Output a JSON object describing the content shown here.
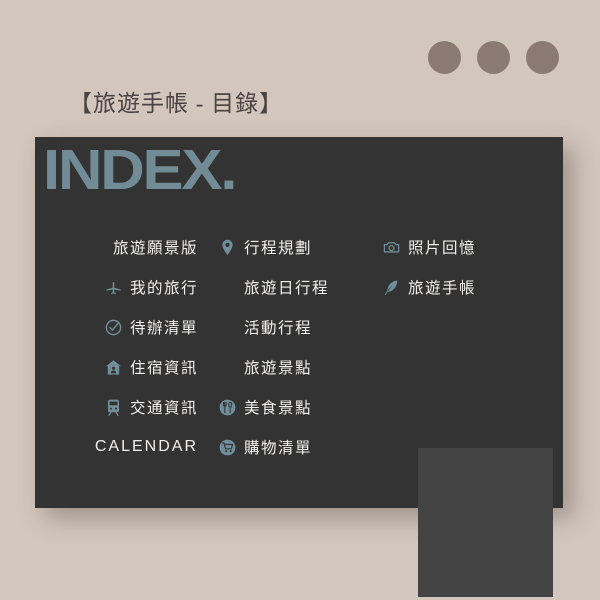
{
  "page": {
    "background_color": "#d2c6bd",
    "title": "【旅遊手帳 - 目錄】"
  },
  "decor": {
    "dot_color": "#8a7a73",
    "dots": [
      "dot-1",
      "dot-2",
      "dot-3"
    ]
  },
  "card": {
    "background_color": "#333333",
    "heading": "INDEX.",
    "heading_color": "#718c96",
    "accent_color": "#6f8e99",
    "text_color": "#f2f0ee",
    "columns": [
      {
        "name": "column-1",
        "items": [
          {
            "label": "旅遊願景版",
            "icon": "none"
          },
          {
            "label": "我的旅行",
            "icon": "airplane-icon"
          },
          {
            "label": "待辦清單",
            "icon": "check-circle-icon"
          },
          {
            "label": "住宿資訊",
            "icon": "house-icon"
          },
          {
            "label": "交通資訊",
            "icon": "train-icon"
          },
          {
            "label": "CALENDAR",
            "icon": "none"
          }
        ]
      },
      {
        "name": "column-2",
        "items": [
          {
            "label": "行程規劃",
            "icon": "map-pin-icon"
          },
          {
            "label": "旅遊日行程",
            "icon": "none"
          },
          {
            "label": "活動行程",
            "icon": "none"
          },
          {
            "label": "旅遊景點",
            "icon": "none"
          },
          {
            "label": "美食景點",
            "icon": "restaurant-icon"
          },
          {
            "label": "購物清單",
            "icon": "shopping-cart-icon"
          }
        ]
      },
      {
        "name": "column-3",
        "items": [
          {
            "label": "照片回憶",
            "icon": "camera-icon"
          },
          {
            "label": "旅遊手帳",
            "icon": "quill-pen-icon"
          }
        ]
      }
    ],
    "placeholder": {
      "name": "image-placeholder",
      "color": "#444444"
    }
  }
}
